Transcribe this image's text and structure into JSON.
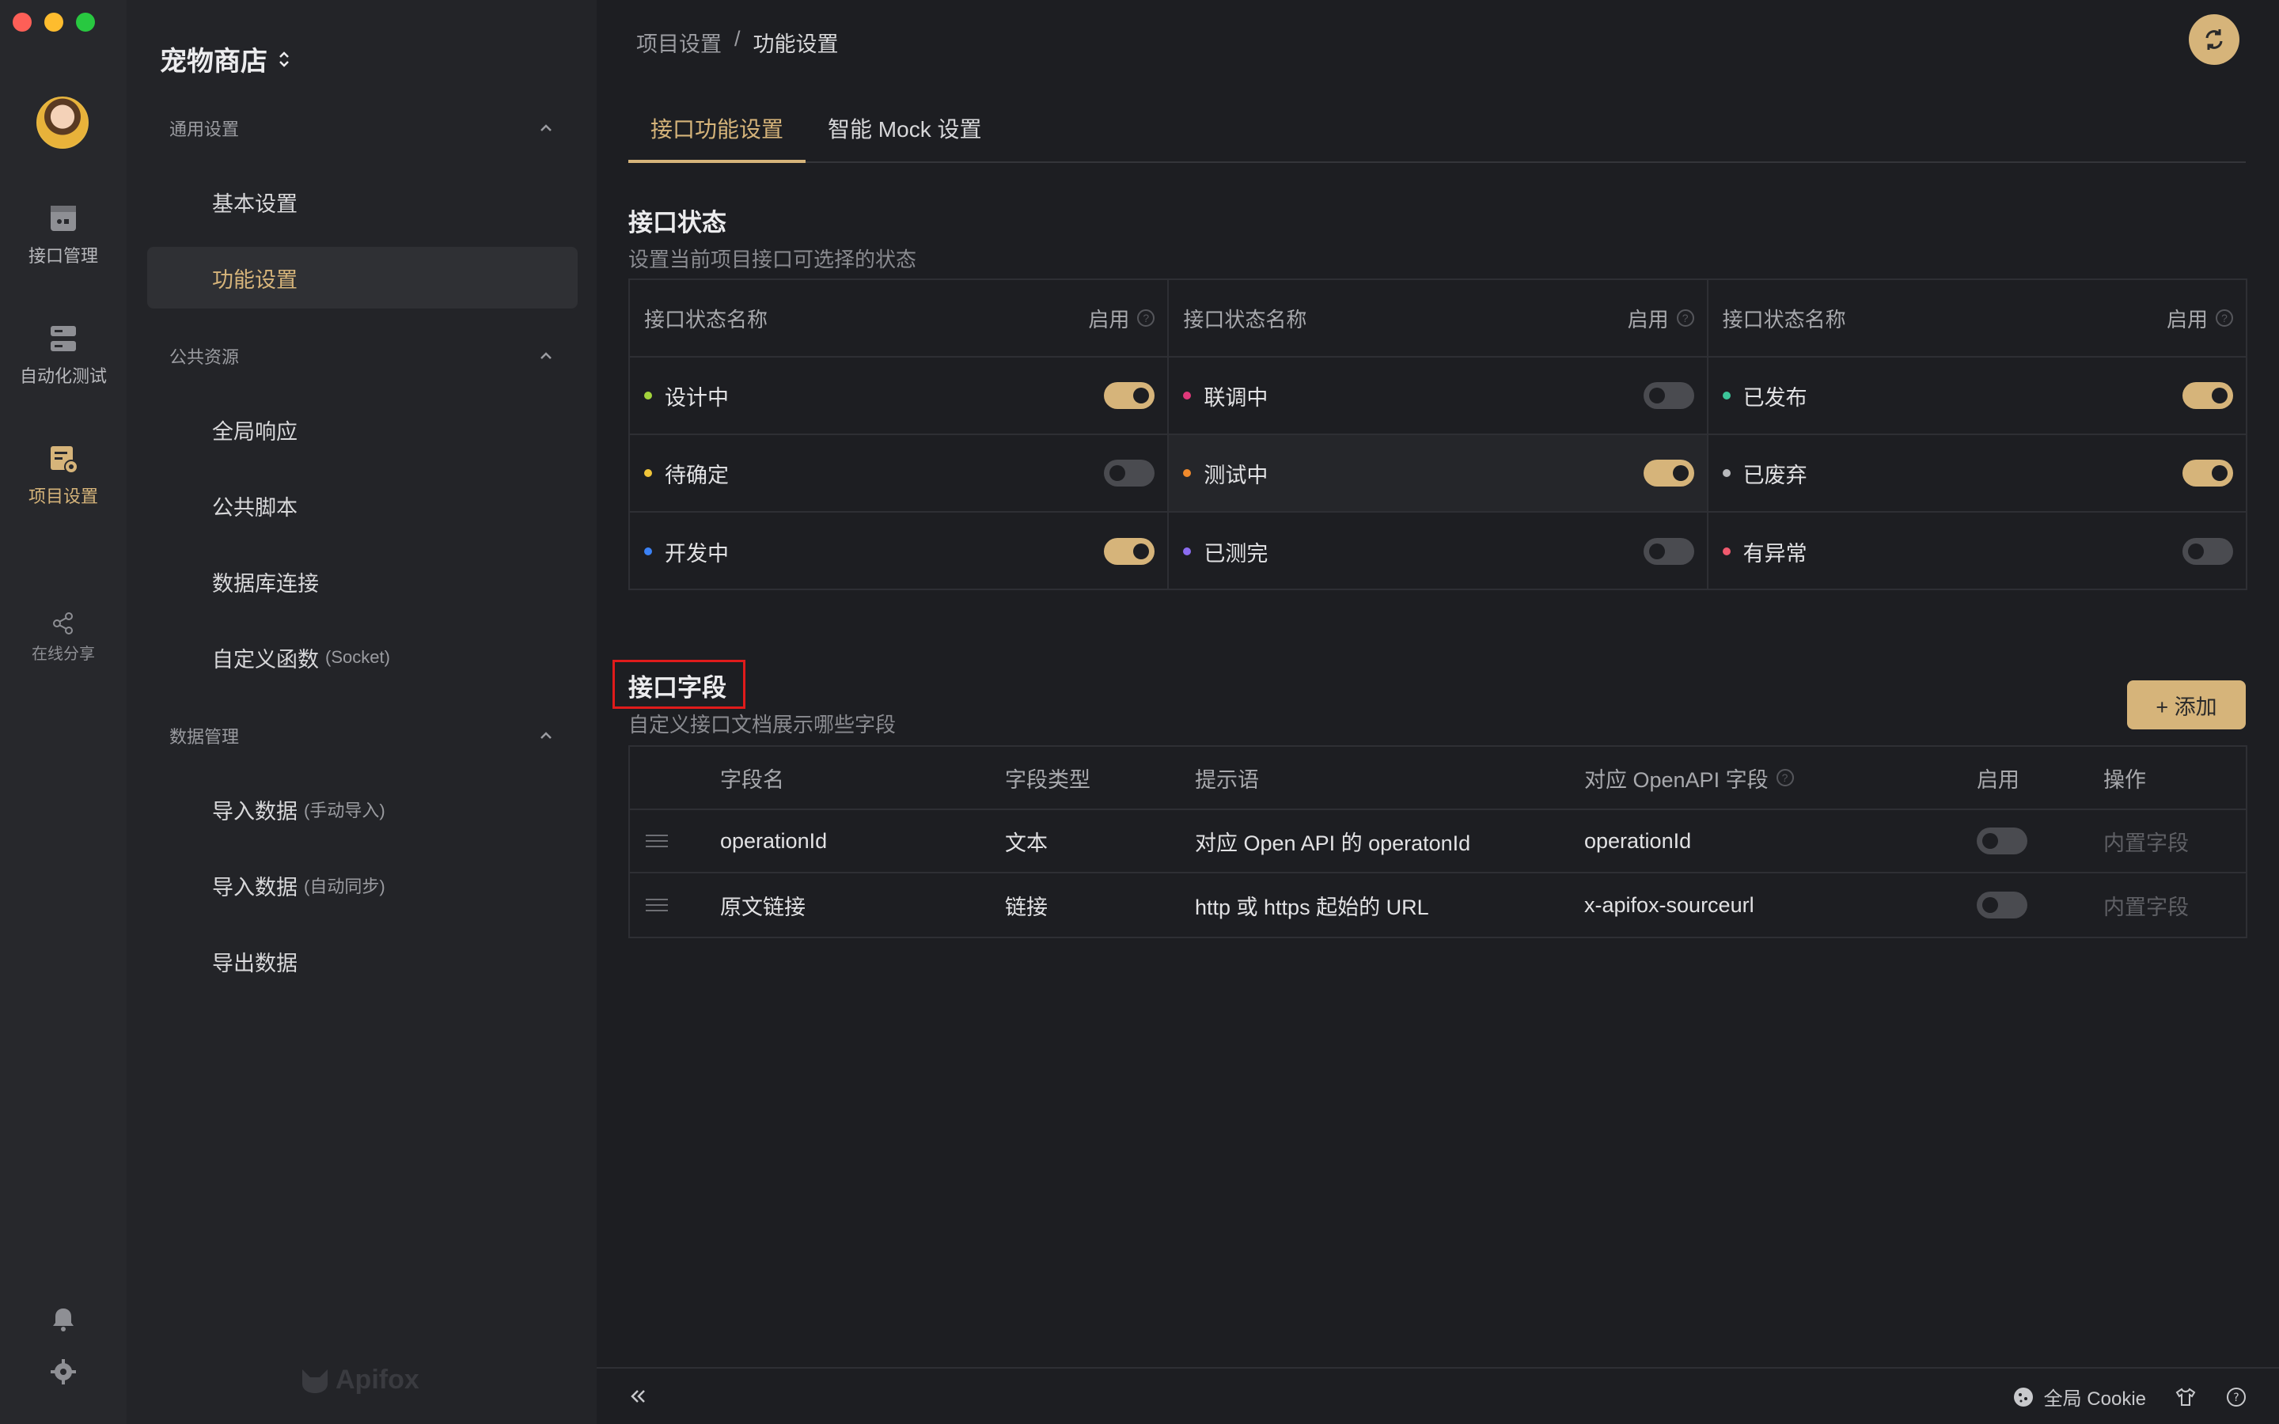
{
  "window": {
    "controls": [
      "close",
      "minimize",
      "maximize"
    ]
  },
  "rail": {
    "items": [
      {
        "label": "接口管理",
        "icon": "api-management-icon"
      },
      {
        "label": "自动化测试",
        "icon": "automation-test-icon"
      },
      {
        "label": "项目设置",
        "icon": "project-settings-icon",
        "active": true
      },
      {
        "label": "在线分享",
        "icon": "share-icon"
      }
    ],
    "bottom_icons": [
      "bell-icon",
      "gear-icon"
    ]
  },
  "sidebar": {
    "project_title": "宠物商店",
    "groups": [
      {
        "title": "通用设置",
        "items": [
          {
            "label": "基本设置"
          },
          {
            "label": "功能设置",
            "active": true
          }
        ]
      },
      {
        "title": "公共资源",
        "items": [
          {
            "label": "全局响应"
          },
          {
            "label": "公共脚本"
          },
          {
            "label": "数据库连接"
          },
          {
            "label": "自定义函数",
            "sub": "(Socket)"
          }
        ]
      },
      {
        "title": "数据管理",
        "items": [
          {
            "label": "导入数据",
            "sub": "(手动导入)"
          },
          {
            "label": "导入数据",
            "sub": "(自动同步)"
          },
          {
            "label": "导出数据"
          }
        ]
      }
    ],
    "watermark": "Apifox"
  },
  "header": {
    "breadcrumb": [
      "项目设置",
      "/",
      "功能设置"
    ]
  },
  "tabs": [
    {
      "label": "接口功能设置",
      "active": true
    },
    {
      "label": "智能 Mock 设置"
    }
  ],
  "status_section": {
    "title": "接口状态",
    "desc": "设置当前项目接口可选择的状态",
    "col_name": "接口状态名称",
    "col_enabled": "启用",
    "columns": [
      [
        {
          "name": "设计中",
          "dot": "#a3d33c",
          "enabled": true
        },
        {
          "name": "待确定",
          "dot": "#f0c53a",
          "enabled": false
        },
        {
          "name": "开发中",
          "dot": "#3b82f6",
          "enabled": true
        }
      ],
      [
        {
          "name": "联调中",
          "dot": "#e0387a",
          "enabled": false
        },
        {
          "name": "测试中",
          "dot": "#f08a2c",
          "enabled": true
        },
        {
          "name": "已测完",
          "dot": "#8b6cf0",
          "enabled": false
        }
      ],
      [
        {
          "name": "已发布",
          "dot": "#3cc69a",
          "enabled": true
        },
        {
          "name": "已废弃",
          "dot": "#b8b9bd",
          "enabled": true
        },
        {
          "name": "有异常",
          "dot": "#f05a6e",
          "enabled": false
        }
      ]
    ]
  },
  "fields_section": {
    "title": "接口字段",
    "desc": "自定义接口文档展示哪些字段",
    "add_label": "+ 添加",
    "headers": [
      "字段名",
      "字段类型",
      "提示语",
      "对应 OpenAPI 字段",
      "启用",
      "操作"
    ],
    "rows": [
      {
        "name": "operationId",
        "type": "文本",
        "hint": "对应 Open API 的 operatonId",
        "openapi": "operationId",
        "enabled": false,
        "action": "内置字段"
      },
      {
        "name": "原文链接",
        "type": "链接",
        "hint": "http 或 https 起始的 URL",
        "openapi": "x-apifox-sourceurl",
        "enabled": false,
        "action": "内置字段"
      }
    ]
  },
  "footer": {
    "cookie_label": "全局 Cookie",
    "icons": [
      "collapse-icon",
      "cookie-icon",
      "shirt-icon",
      "help-icon"
    ]
  },
  "colors": {
    "accent": "#d6b47a",
    "highlight_box": "#e01b1b",
    "background": "#1d1e22"
  }
}
